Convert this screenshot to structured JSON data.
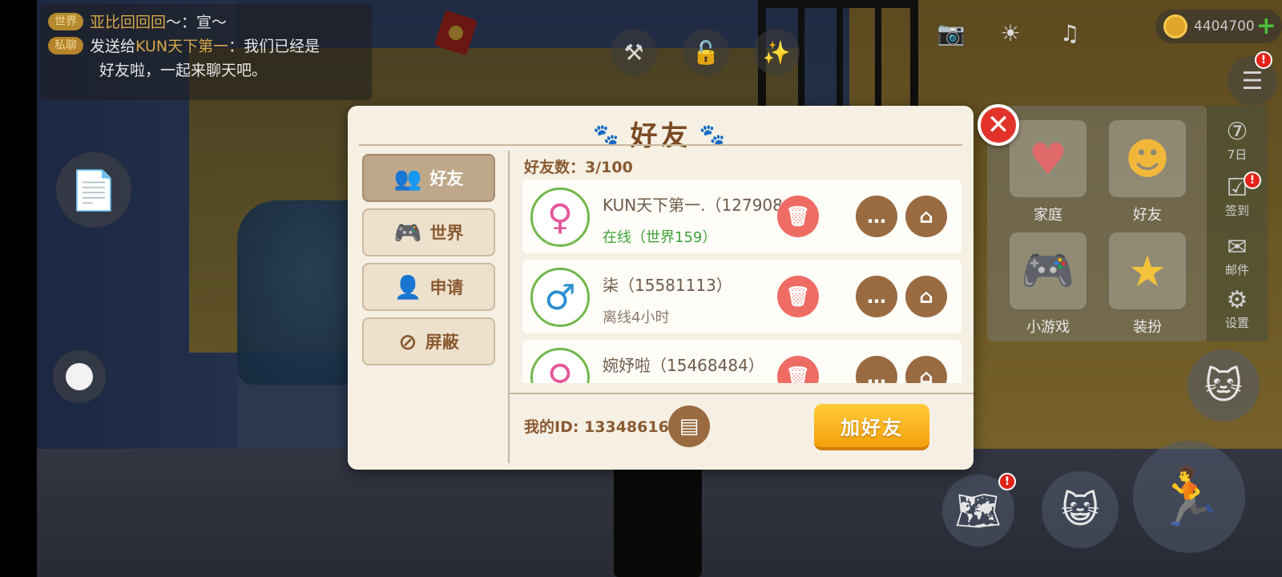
{
  "chat": {
    "line1": {
      "tag": "世界",
      "name": "亚比回回回",
      "text": "～：宣～"
    },
    "line2": {
      "tag": "私聊",
      "prefix": "发送给",
      "target": "KUN天下第一",
      "text": "：我们已经是",
      "text2": "好友啦，一起来聊天吧。"
    }
  },
  "hud": {
    "coins": "4404700",
    "menu_badge": "!",
    "map_badge": "!"
  },
  "side_menu": {
    "items": [
      {
        "label": "家庭",
        "icon": "heart-icon"
      },
      {
        "label": "好友",
        "icon": "friends-icon"
      },
      {
        "label": "小游戏",
        "icon": "gamepad-icon"
      },
      {
        "label": "装扮",
        "icon": "magic-wand-icon"
      }
    ],
    "strip": [
      {
        "label": "7日",
        "icon": "seven-day-icon"
      },
      {
        "label": "签到",
        "icon": "checkin-icon",
        "badge": "!"
      },
      {
        "label": "邮件",
        "icon": "mail-icon"
      },
      {
        "label": "设置",
        "icon": "gear-icon"
      }
    ]
  },
  "dialog": {
    "title": "好友",
    "tabs": [
      {
        "label": "好友",
        "icon": "friends-icon",
        "active": true
      },
      {
        "label": "世界",
        "icon": "gamepad-icon",
        "active": false
      },
      {
        "label": "申请",
        "icon": "add-user-icon",
        "active": false
      },
      {
        "label": "屏蔽",
        "icon": "block-user-icon",
        "active": false
      }
    ],
    "friend_count_label": "好友数：3/100",
    "friends": [
      {
        "name": "KUN天下第一.（12790864）",
        "status": "在线（世界159）",
        "online": true,
        "gender": "female"
      },
      {
        "name": "柒（15581113）",
        "status": "离线4小时",
        "online": false,
        "gender": "male"
      },
      {
        "name": "婉妤啦（15468484）",
        "status": "",
        "online": false,
        "gender": "female"
      }
    ],
    "my_id_label": "我的ID: 13348616",
    "add_friend_label": "加好友"
  },
  "colors": {
    "accent_brown": "#7a4a23",
    "online_green": "#3fa33a",
    "delete_red": "#ee6c64",
    "add_button": "#f4a10c"
  }
}
